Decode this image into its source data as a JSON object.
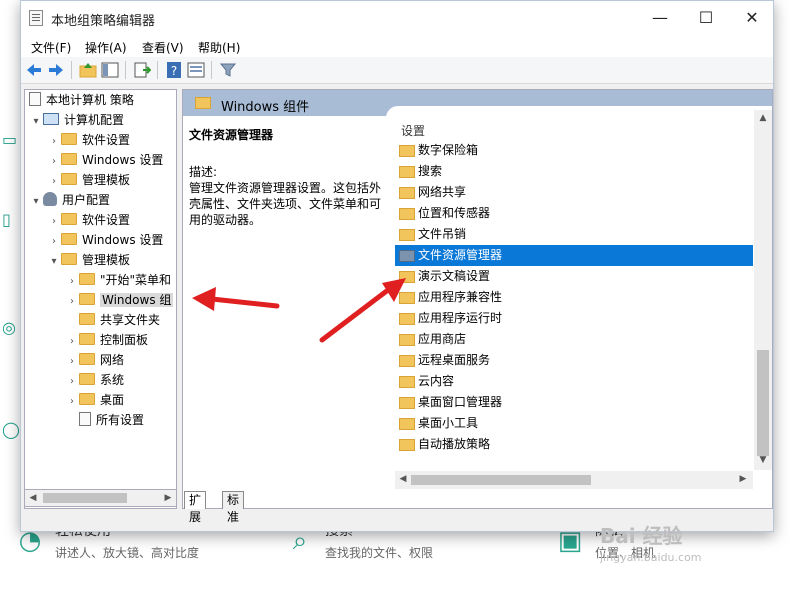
{
  "window": {
    "title": "本地组策略编辑器",
    "controls": {
      "minimize": "—",
      "maximize": "☐",
      "close": "✕"
    }
  },
  "menu": [
    "文件(F)",
    "操作(A)",
    "查看(V)",
    "帮助(H)"
  ],
  "tree": {
    "root": "本地计算机 策略",
    "computer_config": "计算机配置",
    "computer_children": [
      "软件设置",
      "Windows 设置",
      "管理模板"
    ],
    "user_config": "用户配置",
    "user_children": [
      "软件设置",
      "Windows 设置",
      "管理模板"
    ],
    "admin_templates_children": [
      "\"开始\"菜单和",
      "Windows 组",
      "共享文件夹",
      "控制面板",
      "网络",
      "系统",
      "桌面",
      "所有设置"
    ]
  },
  "right": {
    "header": "Windows 组件",
    "desc_title": "文件资源管理器",
    "desc_label": "描述:",
    "desc_text": "管理文件资源管理器设置。这包括外壳属性、文件夹选项、文件菜单和可用的驱动器。",
    "column_header": "设置",
    "items": [
      "数字保险箱",
      "搜索",
      "网络共享",
      "位置和传感器",
      "文件吊销",
      "文件资源管理器",
      "演示文稿设置",
      "应用程序兼容性",
      "应用程序运行时",
      "应用商店",
      "远程桌面服务",
      "云内容",
      "桌面窗口管理器",
      "桌面小工具",
      "自动播放策略"
    ],
    "selected_index": 5
  },
  "tabs": [
    "扩展",
    "标准"
  ],
  "background": {
    "items": [
      {
        "title": "轻松使用",
        "sub": "讲述人、放大镜、高对比度"
      },
      {
        "title": "搜索",
        "sub": "查找我的文件、权限"
      },
      {
        "title": "隐私",
        "sub": "位置、相机"
      }
    ]
  },
  "watermark": {
    "brand": "Bai 经验",
    "url": "jingyan.baidu.com"
  },
  "colors": {
    "selection": "#0a78d7",
    "header": "#a8bcd6",
    "arrow": "#e02020"
  }
}
